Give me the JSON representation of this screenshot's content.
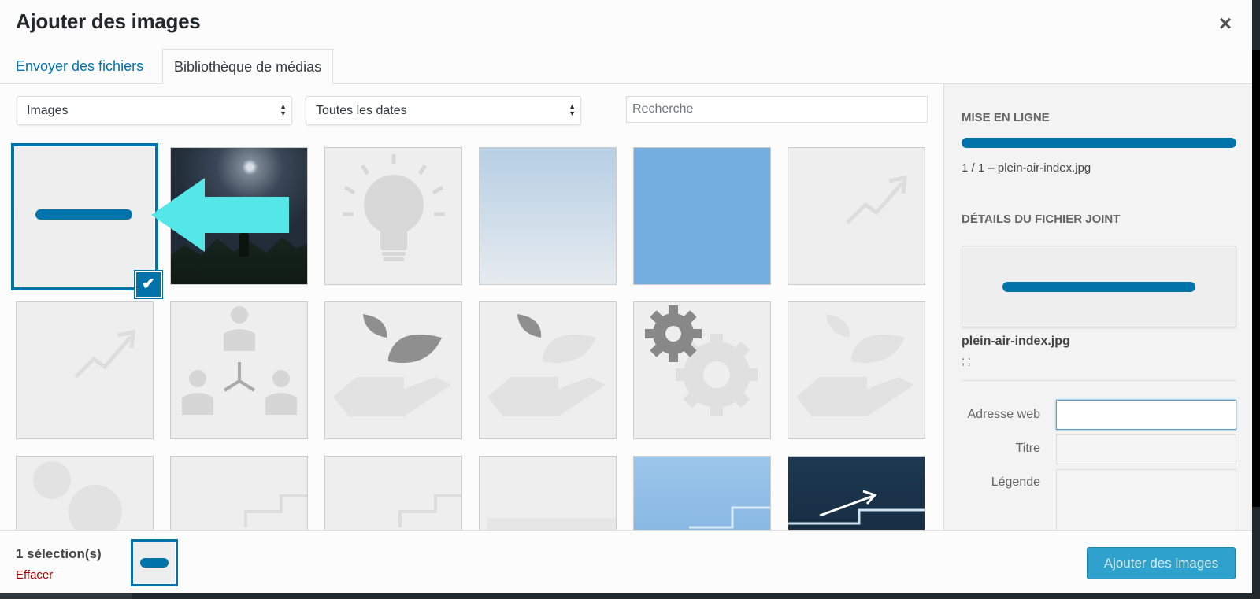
{
  "modal": {
    "title": "Ajouter des images",
    "close_glyph": "×"
  },
  "tabs": [
    {
      "label": "Envoyer des fichiers"
    },
    {
      "label": "Bibliothèque de médias"
    }
  ],
  "filters": {
    "type_value": "Images",
    "date_value": "Toutes les dates",
    "search_placeholder": "Recherche"
  },
  "sidebar": {
    "upload_heading": "MISE EN LIGNE",
    "upload_status": "1 / 1  –  plein-air-index.jpg",
    "upload_progress": 1.0,
    "details_heading": "DÉTAILS DU FICHIER JOINT",
    "filename": "plein-air-index.jpg",
    "meta": "; ;",
    "fields": {
      "url_label": "Adresse web",
      "url_value": "",
      "title_label": "Titre",
      "title_value": "",
      "caption_label": "Légende",
      "caption_value": ""
    }
  },
  "footer": {
    "selection_count": "1 sélection(s)",
    "clear_label": "Effacer",
    "add_button": "Ajouter des images"
  },
  "colors": {
    "accent": "#0073aa",
    "annotation_arrow": "#55e6e8",
    "danger": "#aa0000",
    "button": "#2ea2cc"
  },
  "grid_items": [
    {
      "kind": "dash",
      "selected": true
    },
    {
      "kind": "photo-mountain"
    },
    {
      "kind": "lightbulb-icon"
    },
    {
      "kind": "gradient-light-blue"
    },
    {
      "kind": "solid-blue"
    },
    {
      "kind": "trend-icon"
    },
    {
      "kind": "trend-icon"
    },
    {
      "kind": "org-chart-icon"
    },
    {
      "kind": "hand-leaf-icon"
    },
    {
      "kind": "hand-leaf-icon"
    },
    {
      "kind": "gears-icon"
    },
    {
      "kind": "hand-leaf-icon"
    },
    {
      "kind": "gears-icon"
    },
    {
      "kind": "steps-icon"
    },
    {
      "kind": "steps-icon"
    },
    {
      "kind": "steps-icon"
    },
    {
      "kind": "blue-steps"
    },
    {
      "kind": "dark-growth"
    }
  ]
}
